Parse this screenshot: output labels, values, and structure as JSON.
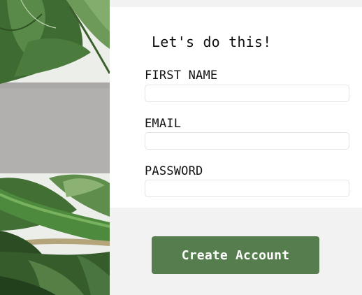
{
  "form": {
    "title": "Let's do this!",
    "fields": [
      {
        "label": "FIRST NAME",
        "value": "",
        "placeholder": ""
      },
      {
        "label": "EMAIL",
        "value": "",
        "placeholder": ""
      },
      {
        "label": "PASSWORD",
        "value": "",
        "placeholder": ""
      }
    ],
    "submit_label": "Create Account"
  },
  "theme": {
    "accent": "#567d4d",
    "page_background": "#f2f2f2",
    "card_background": "#ffffff"
  },
  "image": {
    "subject": "monstera-leaves"
  }
}
